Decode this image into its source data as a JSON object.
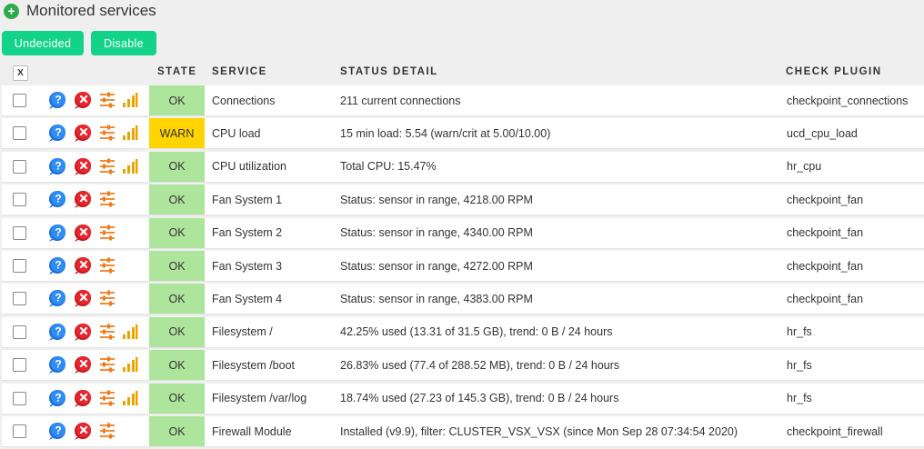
{
  "header": {
    "title": "Monitored services"
  },
  "buttons": {
    "undecided": "Undecided",
    "disable": "Disable"
  },
  "table": {
    "toggle_label": "X",
    "columns": {
      "state": "STATE",
      "service": "SERVICE",
      "detail": "STATUS DETAIL",
      "plugin": "CHECK PLUGIN"
    },
    "rows": [
      {
        "state": "OK",
        "service": "Connections",
        "detail": "211 current connections",
        "plugin": "checkpoint_connections",
        "graph": true
      },
      {
        "state": "WARN",
        "service": "CPU load",
        "detail": "15 min load: 5.54 (warn/crit at 5.00/10.00)",
        "plugin": "ucd_cpu_load",
        "graph": true
      },
      {
        "state": "OK",
        "service": "CPU utilization",
        "detail": "Total CPU: 15.47%",
        "plugin": "hr_cpu",
        "graph": true
      },
      {
        "state": "OK",
        "service": "Fan System 1",
        "detail": "Status: sensor in range, 4218.00 RPM",
        "plugin": "checkpoint_fan",
        "graph": false
      },
      {
        "state": "OK",
        "service": "Fan System 2",
        "detail": "Status: sensor in range, 4340.00 RPM",
        "plugin": "checkpoint_fan",
        "graph": false
      },
      {
        "state": "OK",
        "service": "Fan System 3",
        "detail": "Status: sensor in range, 4272.00 RPM",
        "plugin": "checkpoint_fan",
        "graph": false
      },
      {
        "state": "OK",
        "service": "Fan System 4",
        "detail": "Status: sensor in range, 4383.00 RPM",
        "plugin": "checkpoint_fan",
        "graph": false
      },
      {
        "state": "OK",
        "service": "Filesystem /",
        "detail": "42.25% used (13.31 of 31.5 GB), trend: 0 B / 24 hours",
        "plugin": "hr_fs",
        "graph": true
      },
      {
        "state": "OK",
        "service": "Filesystem /boot",
        "detail": "26.83% used (77.4 of 288.52 MB), trend: 0 B / 24 hours",
        "plugin": "hr_fs",
        "graph": true
      },
      {
        "state": "OK",
        "service": "Filesystem /var/log",
        "detail": "18.74% used (27.23 of 145.3 GB), trend: 0 B / 24 hours",
        "plugin": "hr_fs",
        "graph": true
      },
      {
        "state": "OK",
        "service": "Firewall Module",
        "detail": "Installed (v9.9), filter: CLUSTER_VSX_VSX (since Mon Sep 28 07:34:54 2020)",
        "plugin": "checkpoint_firewall",
        "graph": false
      }
    ]
  },
  "icons": {
    "help": "help-icon",
    "remove": "remove-icon",
    "parameters": "parameters-icon",
    "graph": "graph-icon"
  },
  "colors": {
    "ok": "#aee59d",
    "warn": "#ffd400",
    "button": "#13d389",
    "plus": "#2eaa4a"
  }
}
